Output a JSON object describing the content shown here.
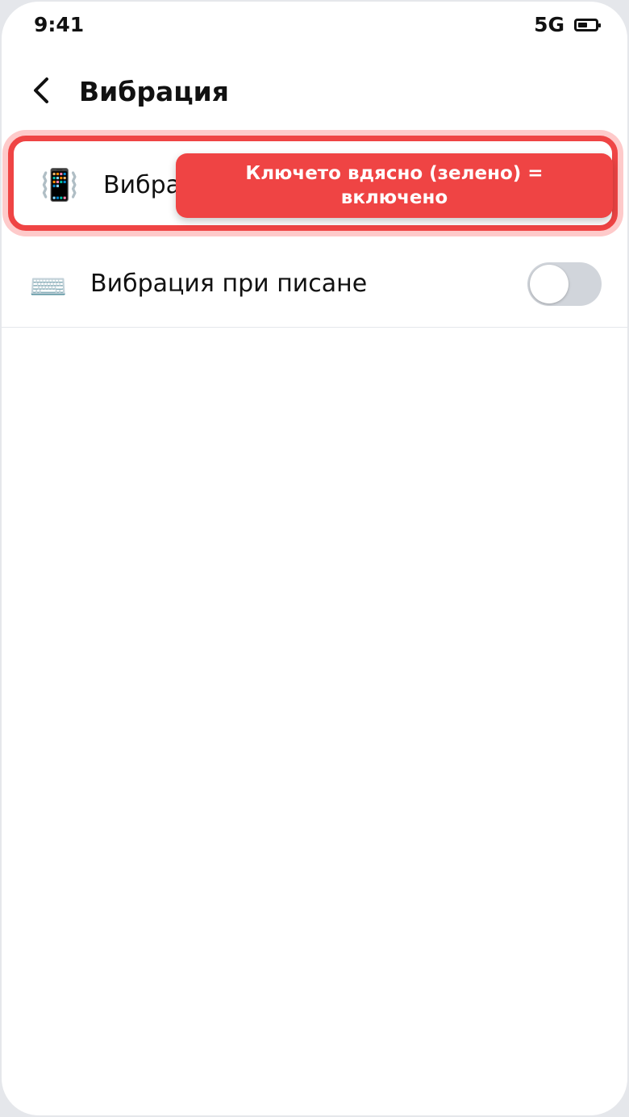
{
  "status_bar": {
    "time": "9:41",
    "network": "5G",
    "battery_level": 0.55
  },
  "header": {
    "back_icon": "chevron-left-icon",
    "title": "Вибрация"
  },
  "settings": [
    {
      "icon": "📳",
      "icon_name": "vibrating-phone-icon",
      "label": "Вибра",
      "highlighted": true
    },
    {
      "icon": "⌨️",
      "icon_name": "keyboard-icon",
      "label": "Вибрация при писане",
      "toggle_on": false
    }
  ],
  "tooltip": {
    "text": "Ключето вдясно (зелено) = включено"
  },
  "colors": {
    "highlight_border": "#ef4444",
    "highlight_glow": "#fecaca",
    "tooltip_bg": "#ef4444",
    "toggle_off": "#d1d5db"
  }
}
